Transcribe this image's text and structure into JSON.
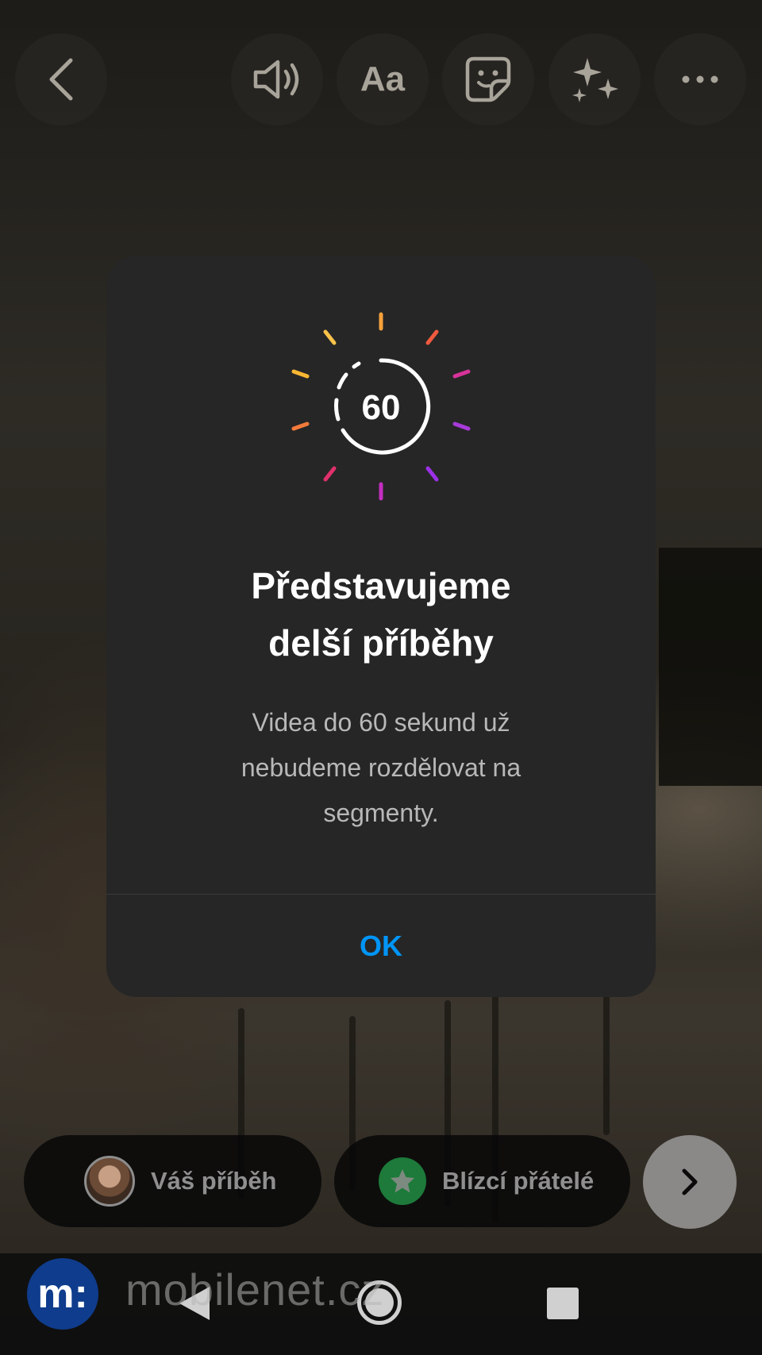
{
  "toolbar": {
    "back": "back-icon",
    "sound": "speaker-icon",
    "text_label": "Aa",
    "sticker": "sticker-icon",
    "effects": "sparkles-icon",
    "more": "more-icon"
  },
  "modal": {
    "badge_number": "60",
    "title_line1": "Představujeme",
    "title_line2": "delší příběhy",
    "description": "Videa do 60 sekund už nebudeme rozdělovat na segmenty.",
    "ok_label": "OK"
  },
  "share": {
    "your_story_label": "Váš příběh",
    "close_friends_label": "Blízcí přátelé"
  },
  "watermark": {
    "logo_letter": "m:",
    "text": "mobilenet.cz"
  },
  "colors": {
    "accent": "#0095f6",
    "modal_bg": "#262626",
    "close_friends_green": "#1d7a3a"
  }
}
